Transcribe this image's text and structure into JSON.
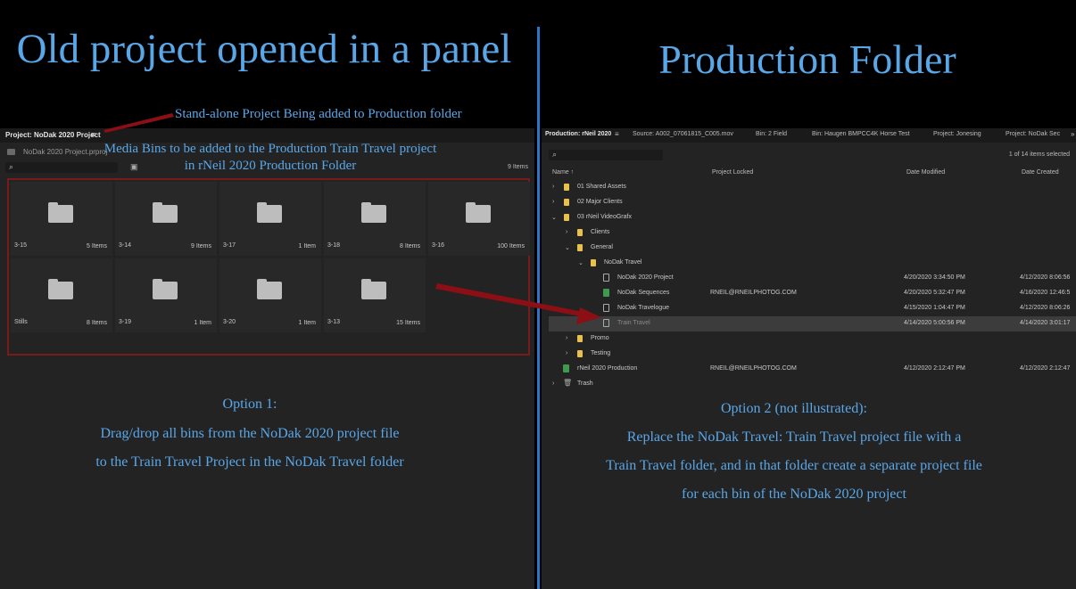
{
  "titles": {
    "left": "Old project opened in a panel",
    "right": "Production Folder"
  },
  "annotations": {
    "standalone": "Stand-alone Project Being added to Production folder",
    "media_bins_line1": "Media Bins to be added to the Production Train Travel project",
    "media_bins_line2": "in rNeil 2020 Production Folder",
    "option1_title": "Option 1:",
    "option1_line1": "Drag/drop all bins from the NoDak 2020 project file",
    "option1_line2": "to the Train Travel Project in the NoDak Travel folder",
    "option2_title": "Option 2 (not illustrated):",
    "option2_line1": "Replace the NoDak Travel:  Train Travel project file with a",
    "option2_line2": "Train Travel folder, and in that folder create a separate project file",
    "option2_line3": "for each bin of the NoDak 2020 project"
  },
  "left_panel": {
    "tab_label": "Project: NoDak 2020 Project",
    "menu_icon": "≡",
    "file_name": "NoDak 2020 Project.prproj",
    "item_count": "9 Items",
    "bins": [
      {
        "name": "3-15",
        "count": "5 Items"
      },
      {
        "name": "3-14",
        "count": "9 Items"
      },
      {
        "name": "3-17",
        "count": "1 Item"
      },
      {
        "name": "3-18",
        "count": "8 Items"
      },
      {
        "name": "3-16",
        "count": "100 Items"
      },
      {
        "name": "Stills",
        "count": "8 Items"
      },
      {
        "name": "3-19",
        "count": "1 Item"
      },
      {
        "name": "3-20",
        "count": "1 Item"
      },
      {
        "name": "3-13",
        "count": "15 Items"
      }
    ]
  },
  "right_panel": {
    "tabs": [
      "Production: rNeil 2020",
      "Source: A002_07061815_C005.mov",
      "Bin: 2 Field",
      "Bin: Haugen BMPCC4K Horse Test",
      "Project: Jonesing",
      "Project: NoDak Sec"
    ],
    "menu_icon": "≡",
    "close": "»",
    "selected_info": "1 of 14 items selected",
    "columns": {
      "name": "Name",
      "locked": "Project Locked",
      "modified": "Date Modified",
      "created": "Date Created"
    },
    "rows": [
      {
        "name": "01 Shared Assets",
        "locked": "",
        "modified": "",
        "created": ""
      },
      {
        "name": "02 Major Clients",
        "locked": "",
        "modified": "",
        "created": ""
      },
      {
        "name": "03  rNeil VideoGrafx",
        "locked": "",
        "modified": "",
        "created": ""
      },
      {
        "name": "Clients",
        "locked": "",
        "modified": "",
        "created": ""
      },
      {
        "name": "General",
        "locked": "",
        "modified": "",
        "created": ""
      },
      {
        "name": "NoDak Travel",
        "locked": "",
        "modified": "",
        "created": ""
      },
      {
        "name": "NoDak 2020 Project",
        "locked": "",
        "modified": "4/20/2020 3:34:50 PM",
        "created": "4/12/2020 8:06:56"
      },
      {
        "name": "NoDak Sequences",
        "locked": "RNEIL@RNEILPHOTOG.COM",
        "modified": "4/20/2020 5:32:47 PM",
        "created": "4/16/2020 12:46:5"
      },
      {
        "name": "NoDak Travelogue",
        "locked": "",
        "modified": "4/15/2020 1:04:47 PM",
        "created": "4/12/2020 8:06:26"
      },
      {
        "name": "Train Travel",
        "locked": "",
        "modified": "4/14/2020 5:00:56 PM",
        "created": "4/14/2020 3:01:17"
      },
      {
        "name": "Promo",
        "locked": "",
        "modified": "",
        "created": ""
      },
      {
        "name": "Testing",
        "locked": "",
        "modified": "",
        "created": ""
      },
      {
        "name": "rNeil 2020 Production",
        "locked": "RNEIL@RNEILPHOTOG.COM",
        "modified": "4/12/2020 2:12:47 PM",
        "created": "4/12/2020 2:12:47"
      },
      {
        "name": "Trash",
        "locked": "",
        "modified": "",
        "created": ""
      }
    ]
  },
  "colors": {
    "accent_blue": "#5aa7e8",
    "divider_blue": "#2e74c8",
    "arrow_red": "#8b0f14",
    "folder_yellow": "#e8c04a"
  }
}
